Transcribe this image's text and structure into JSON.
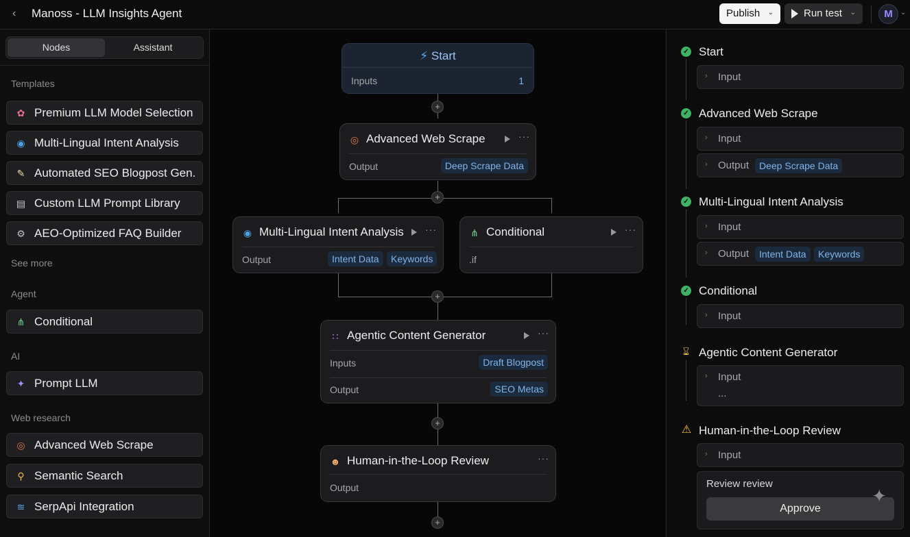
{
  "header": {
    "title": "Manoss - LLM Insights Agent",
    "publish_label": "Publish",
    "run_label": "Run test",
    "avatar_letter": "M"
  },
  "sidebar": {
    "tabs": [
      {
        "label": "Nodes",
        "active": true
      },
      {
        "label": "Assistant",
        "active": false
      }
    ],
    "sections": {
      "templates": "Templates",
      "agent": "Agent",
      "ai": "AI",
      "web_research": "Web research"
    },
    "templates": [
      {
        "label": "Premium LLM Model Selection",
        "icon": "brain-icon"
      },
      {
        "label": "Multi-Lingual Intent Analysis",
        "icon": "globe-icon"
      },
      {
        "label": "Automated SEO Blogpost Gen.",
        "icon": "memo-icon"
      },
      {
        "label": "Custom LLM Prompt Library",
        "icon": "library-icon"
      },
      {
        "label": "AEO-Optimized FAQ Builder",
        "icon": "gear-icon"
      }
    ],
    "see_more": "See more",
    "agent_items": [
      {
        "label": "Conditional",
        "icon": "branch-icon"
      }
    ],
    "ai_items": [
      {
        "label": "Prompt LLM",
        "icon": "sparkle-icon"
      }
    ],
    "web_items": [
      {
        "label": "Advanced Web Scrape",
        "icon": "globe-net-icon"
      },
      {
        "label": "Semantic Search",
        "icon": "search-doc-icon"
      },
      {
        "label": "SerpApi Integration",
        "icon": "signal-icon"
      }
    ]
  },
  "canvas": {
    "start": {
      "title": "Start",
      "inputs_label": "Inputs",
      "inputs_count": "1"
    },
    "scrape": {
      "title": "Advanced Web Scrape",
      "output_label": "Output",
      "chip": "Deep Scrape Data"
    },
    "intent": {
      "title": "Multi-Lingual Intent Analysis",
      "output_label": "Output",
      "chips": [
        "Intent Data",
        "Keywords"
      ]
    },
    "conditional": {
      "title": "Conditional",
      "body": ".if"
    },
    "generator": {
      "title": "Agentic Content Generator",
      "inputs_label": "Inputs",
      "input_chip": "Draft Blogpost",
      "output_label": "Output",
      "output_chip": "SEO Metas"
    },
    "review": {
      "title": "Human-in-the-Loop Review",
      "output_label": "Output"
    },
    "plus_symbol": "+"
  },
  "run_panel": {
    "steps": [
      {
        "title": "Start",
        "status": "success",
        "input": "Input"
      },
      {
        "title": "Advanced Web Scrape",
        "status": "success",
        "input": "Input",
        "output": "Output",
        "output_chips": [
          "Deep Scrape Data"
        ]
      },
      {
        "title": "Multi-Lingual Intent Analysis",
        "status": "success",
        "input": "Input",
        "output": "Output",
        "output_chips": [
          "Intent Data",
          "Keywords"
        ]
      },
      {
        "title": "Conditional",
        "status": "success",
        "input": "Input"
      },
      {
        "title": "Agentic Content Generator",
        "status": "running",
        "input": "Input",
        "ellipsis": "..."
      },
      {
        "title": "Human-in-the-Loop Review",
        "status": "warning",
        "input": "Input"
      }
    ],
    "review_label": "Review review",
    "approve_label": "Approve"
  },
  "colors": {
    "success": "#3fb364",
    "warning": "#f2c230",
    "chip_text": "#7fb4ea",
    "chip_bg": "#1b2a3c",
    "start_text": "#9cc3f5"
  }
}
